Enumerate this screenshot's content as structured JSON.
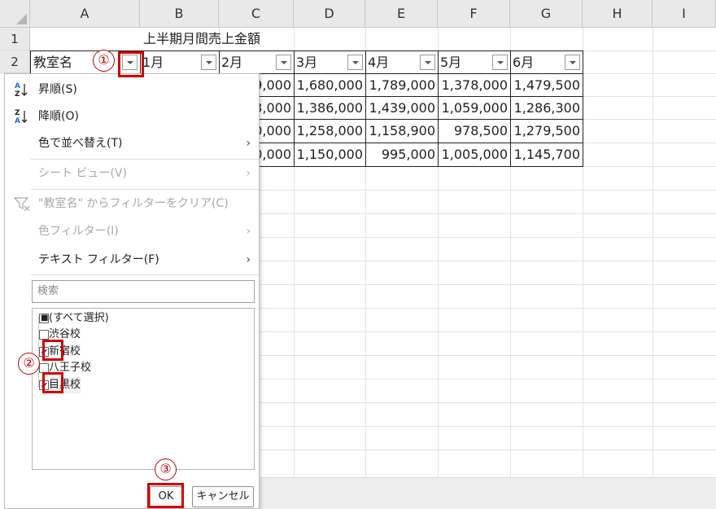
{
  "sheet": {
    "columns": [
      "A",
      "B",
      "C",
      "D",
      "E",
      "F",
      "G",
      "H",
      "I"
    ],
    "rows": [
      "1",
      "2"
    ],
    "title": "上半期月間売上金額",
    "header": [
      "教室名",
      "1月",
      "2月",
      "3月",
      "4月",
      "5月",
      "6月"
    ],
    "data_rows": [
      {
        "b_partial": "9,000",
        "cols": [
          "1,680,000",
          "1,789,000",
          "1,378,000",
          "1,479,500"
        ]
      },
      {
        "b_partial": "3,000",
        "cols": [
          "1,386,000",
          "1,439,000",
          "1,059,000",
          "1,286,300"
        ]
      },
      {
        "b_partial": "0,000",
        "cols": [
          "1,258,000",
          "1,158,900",
          "978,500",
          "1,279,500"
        ]
      },
      {
        "b_partial": "0,000",
        "cols": [
          "1,150,000",
          "995,000",
          "1,005,000",
          "1,145,700"
        ]
      }
    ]
  },
  "menu": {
    "sort_asc": "昇順(S)",
    "sort_desc": "降順(O)",
    "sort_by_color": "色で並べ替え(T)",
    "sheet_view": "シート ビュー(V)",
    "clear_filter": "\"教室名\" からフィルターをクリア(C)",
    "color_filter": "色フィルター(I)",
    "text_filter": "テキスト フィルター(F)",
    "chevron": "›"
  },
  "search": {
    "placeholder": "検索"
  },
  "list": {
    "select_all": "(すべて選択)",
    "items": [
      {
        "label": "渋谷校",
        "checked": false
      },
      {
        "label": "新宿校",
        "checked": true
      },
      {
        "label": "八王子校",
        "checked": false
      },
      {
        "label": "目黒校",
        "checked": true
      }
    ],
    "check_mark": "✔",
    "partial_mark": "■"
  },
  "buttons": {
    "ok": "OK",
    "cancel": "キャンセル"
  },
  "annotations": {
    "step1": "①",
    "step2": "②",
    "step3": "③"
  },
  "colors": {
    "annotation_red": "#d40000",
    "header_gray": "#e9e9e9",
    "sort_icon_blue": "#1f6fc0"
  }
}
